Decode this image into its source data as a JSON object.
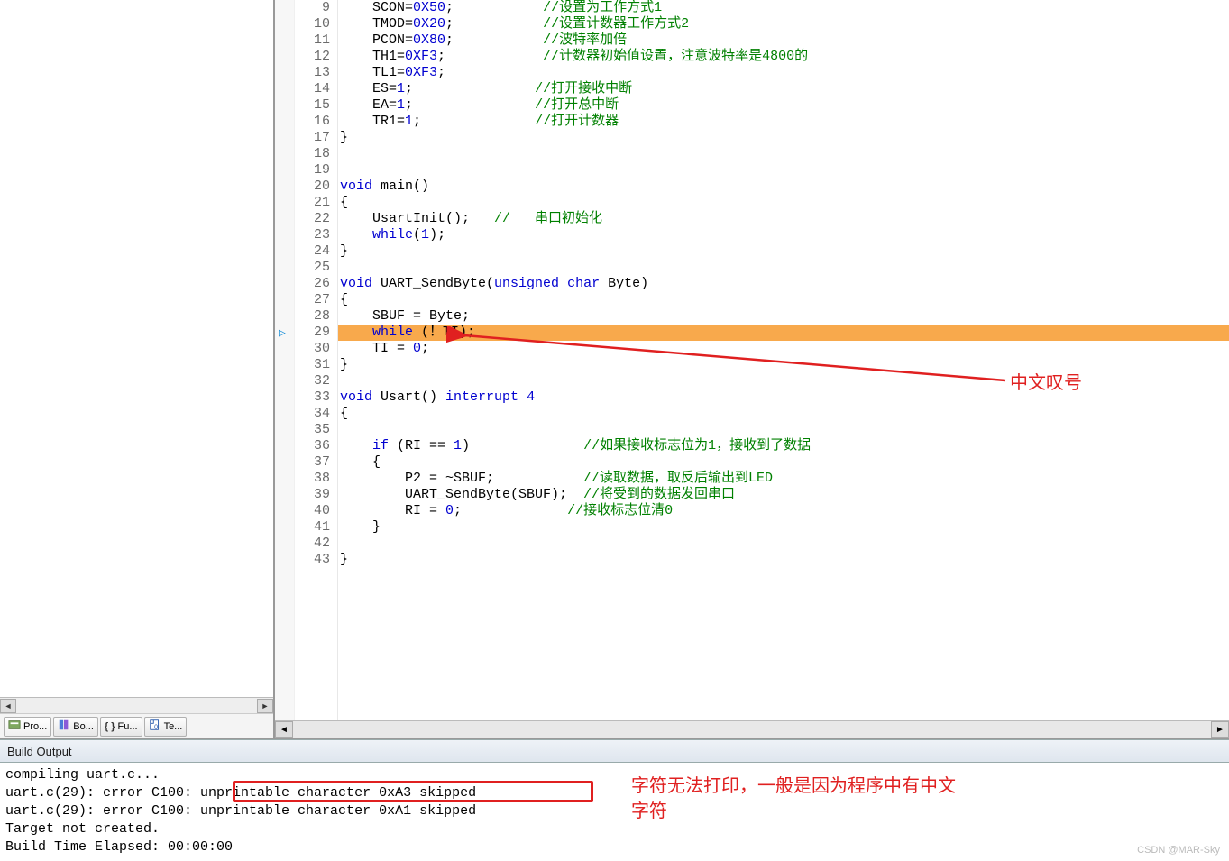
{
  "tabs": {
    "project": "Pro...",
    "books": "Bo...",
    "functions": "Fu...",
    "templates": "Te..."
  },
  "build_output_title": "Build Output",
  "annotations": {
    "line29_label": "中文叹号",
    "build_label_line1": "字符无法打印，一般是因为程序中有中文",
    "build_label_line2": "字符"
  },
  "watermark": "CSDN @MAR-Sky",
  "cursor_line": 29,
  "highlighted_line": 29,
  "code_lines": [
    {
      "n": 9,
      "segs": [
        {
          "t": "    SCON="
        },
        {
          "t": "0X50",
          "c": "kw"
        },
        {
          "t": ";           "
        },
        {
          "t": "//设置为工作方式1",
          "c": "cm"
        }
      ]
    },
    {
      "n": 10,
      "segs": [
        {
          "t": "    TMOD="
        },
        {
          "t": "0X20",
          "c": "kw"
        },
        {
          "t": ";           "
        },
        {
          "t": "//设置计数器工作方式2",
          "c": "cm"
        }
      ]
    },
    {
      "n": 11,
      "segs": [
        {
          "t": "    PCON="
        },
        {
          "t": "0X80",
          "c": "kw"
        },
        {
          "t": ";           "
        },
        {
          "t": "//波特率加倍",
          "c": "cm"
        }
      ]
    },
    {
      "n": 12,
      "segs": [
        {
          "t": "    TH1="
        },
        {
          "t": "0XF3",
          "c": "kw"
        },
        {
          "t": ";            "
        },
        {
          "t": "//计数器初始值设置，注意波特率是4800的",
          "c": "cm"
        }
      ]
    },
    {
      "n": 13,
      "segs": [
        {
          "t": "    TL1="
        },
        {
          "t": "0XF3",
          "c": "kw"
        },
        {
          "t": ";"
        }
      ]
    },
    {
      "n": 14,
      "segs": [
        {
          "t": "    ES="
        },
        {
          "t": "1",
          "c": "kw"
        },
        {
          "t": ";               "
        },
        {
          "t": "//打开接收中断",
          "c": "cm"
        }
      ]
    },
    {
      "n": 15,
      "segs": [
        {
          "t": "    EA="
        },
        {
          "t": "1",
          "c": "kw"
        },
        {
          "t": ";               "
        },
        {
          "t": "//打开总中断",
          "c": "cm"
        }
      ]
    },
    {
      "n": 16,
      "segs": [
        {
          "t": "    TR1="
        },
        {
          "t": "1",
          "c": "kw"
        },
        {
          "t": ";              "
        },
        {
          "t": "//打开计数器",
          "c": "cm"
        }
      ]
    },
    {
      "n": 17,
      "segs": [
        {
          "t": "}"
        }
      ]
    },
    {
      "n": 18,
      "segs": [
        {
          "t": " "
        }
      ]
    },
    {
      "n": 19,
      "segs": [
        {
          "t": " "
        }
      ]
    },
    {
      "n": 20,
      "segs": [
        {
          "t": "void",
          "c": "kw"
        },
        {
          "t": " main()"
        }
      ]
    },
    {
      "n": 21,
      "segs": [
        {
          "t": "{"
        }
      ]
    },
    {
      "n": 22,
      "segs": [
        {
          "t": "    UsartInit();   "
        },
        {
          "t": "//   串口初始化",
          "c": "cm"
        }
      ]
    },
    {
      "n": 23,
      "segs": [
        {
          "t": "    "
        },
        {
          "t": "while",
          "c": "kw"
        },
        {
          "t": "("
        },
        {
          "t": "1",
          "c": "kw"
        },
        {
          "t": ");"
        }
      ]
    },
    {
      "n": 24,
      "segs": [
        {
          "t": "}"
        }
      ]
    },
    {
      "n": 25,
      "segs": [
        {
          "t": " "
        }
      ]
    },
    {
      "n": 26,
      "segs": [
        {
          "t": "void",
          "c": "kw"
        },
        {
          "t": " UART_SendByte("
        },
        {
          "t": "unsigned",
          "c": "kw"
        },
        {
          "t": " "
        },
        {
          "t": "char",
          "c": "kw"
        },
        {
          "t": " Byte)"
        }
      ]
    },
    {
      "n": 27,
      "segs": [
        {
          "t": "{"
        }
      ]
    },
    {
      "n": 28,
      "segs": [
        {
          "t": "    SBUF = Byte;"
        }
      ]
    },
    {
      "n": 29,
      "segs": [
        {
          "t": "    "
        },
        {
          "t": "while",
          "c": "kw"
        },
        {
          "t": " (！TI);"
        }
      ],
      "hl": true
    },
    {
      "n": 30,
      "segs": [
        {
          "t": "    TI = "
        },
        {
          "t": "0",
          "c": "kw"
        },
        {
          "t": ";"
        }
      ]
    },
    {
      "n": 31,
      "segs": [
        {
          "t": "}"
        }
      ]
    },
    {
      "n": 32,
      "segs": [
        {
          "t": " "
        }
      ]
    },
    {
      "n": 33,
      "segs": [
        {
          "t": "void",
          "c": "kw"
        },
        {
          "t": " Usart() "
        },
        {
          "t": "interrupt",
          "c": "kw"
        },
        {
          "t": " "
        },
        {
          "t": "4",
          "c": "kw"
        }
      ]
    },
    {
      "n": 34,
      "segs": [
        {
          "t": "{"
        }
      ]
    },
    {
      "n": 35,
      "segs": [
        {
          "t": " "
        }
      ]
    },
    {
      "n": 36,
      "segs": [
        {
          "t": "    "
        },
        {
          "t": "if",
          "c": "kw"
        },
        {
          "t": " (RI == "
        },
        {
          "t": "1",
          "c": "kw"
        },
        {
          "t": ")              "
        },
        {
          "t": "//如果接收标志位为1，接收到了数据",
          "c": "cm"
        }
      ]
    },
    {
      "n": 37,
      "segs": [
        {
          "t": "    {"
        }
      ]
    },
    {
      "n": 38,
      "segs": [
        {
          "t": "        P2 = ~SBUF;           "
        },
        {
          "t": "//读取数据，取反后输出到LED",
          "c": "cm"
        }
      ]
    },
    {
      "n": 39,
      "segs": [
        {
          "t": "        UART_SendByte(SBUF);  "
        },
        {
          "t": "//将受到的数据发回串口",
          "c": "cm"
        }
      ]
    },
    {
      "n": 40,
      "segs": [
        {
          "t": "        RI = "
        },
        {
          "t": "0",
          "c": "kw"
        },
        {
          "t": ";             "
        },
        {
          "t": "//接收标志位清0",
          "c": "cm"
        }
      ]
    },
    {
      "n": 41,
      "segs": [
        {
          "t": "    }"
        }
      ]
    },
    {
      "n": 42,
      "segs": [
        {
          "t": " "
        }
      ]
    },
    {
      "n": 43,
      "segs": [
        {
          "t": "}"
        }
      ]
    }
  ],
  "build_lines": [
    "compiling uart.c...",
    "uart.c(29): error C100: unprintable character 0xA3 skipped",
    "uart.c(29): error C100: unprintable character 0xA1 skipped",
    "Target not created.",
    "Build Time Elapsed:  00:00:00"
  ]
}
